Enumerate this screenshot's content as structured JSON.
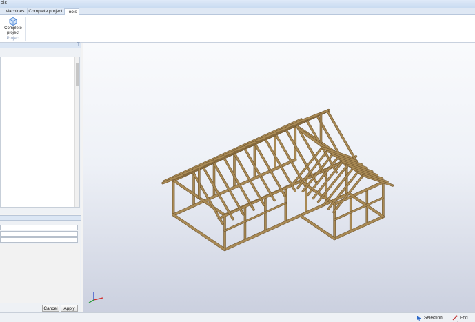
{
  "window": {
    "title": "ols"
  },
  "tabs": [
    {
      "label": "Machines"
    },
    {
      "label": "Complete project"
    },
    {
      "label": "Tools"
    }
  ],
  "ribbon": {
    "button_label_line1": "Complete",
    "button_label_line2": "project",
    "group_label": "Project"
  },
  "panel": {
    "pin_glyph": "ᛘ"
  },
  "properties": {
    "cancel_label": "Cancel",
    "apply_label": "Apply"
  },
  "status": {
    "selection_label": "Selection",
    "endpoint_label": "End poin"
  },
  "colors": {
    "timber": "#a98a55",
    "timber_dark": "#6f5630",
    "axis_x": "#d12a2a",
    "axis_y": "#2a9b3a",
    "axis_z": "#2a47c9"
  }
}
